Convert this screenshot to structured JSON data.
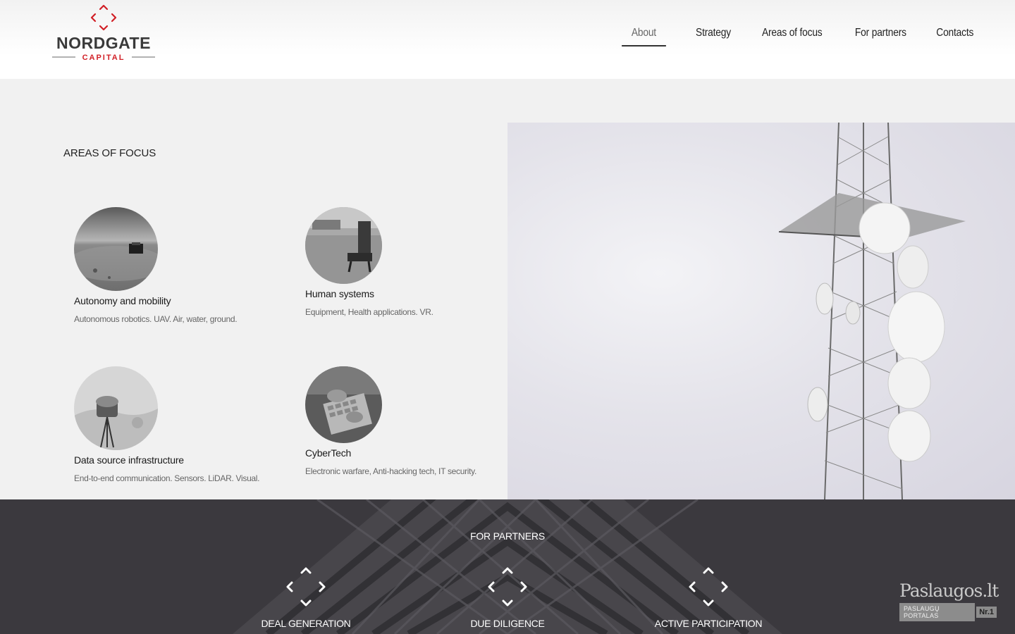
{
  "brand": {
    "name": "NORDGATE",
    "sub": "CAPITAL",
    "accent": "#d11f26"
  },
  "nav": [
    {
      "label": "About",
      "active": true
    },
    {
      "label": "Strategy"
    },
    {
      "label": "Areas of focus"
    },
    {
      "label": "For partners"
    },
    {
      "label": "Contacts"
    }
  ],
  "areas": {
    "title": "AREAS OF FOCUS",
    "items": [
      {
        "title": "Autonomy and mobility",
        "desc": "Autonomous robotics. UAV. Air, water, ground."
      },
      {
        "title": "Human systems",
        "desc": "Equipment, Health applications. VR."
      },
      {
        "title": "Data source infrastructure",
        "desc": "End-to-end communication. Sensors. LiDAR. Visual."
      },
      {
        "title": "CyberTech",
        "desc": "Electronic warfare, Anti-hacking tech, IT security."
      }
    ]
  },
  "partners": {
    "title": "FOR PARTNERS",
    "items": [
      {
        "label": "DEAL GENERATION"
      },
      {
        "label": "DUE DILIGENCE"
      },
      {
        "label": "ACTIVE PARTICIPATION"
      }
    ]
  },
  "badge": {
    "name": "Paslaugos.lt",
    "tagline": "PASLAUGŲ PORTALAS",
    "rank": "Nr.1"
  }
}
